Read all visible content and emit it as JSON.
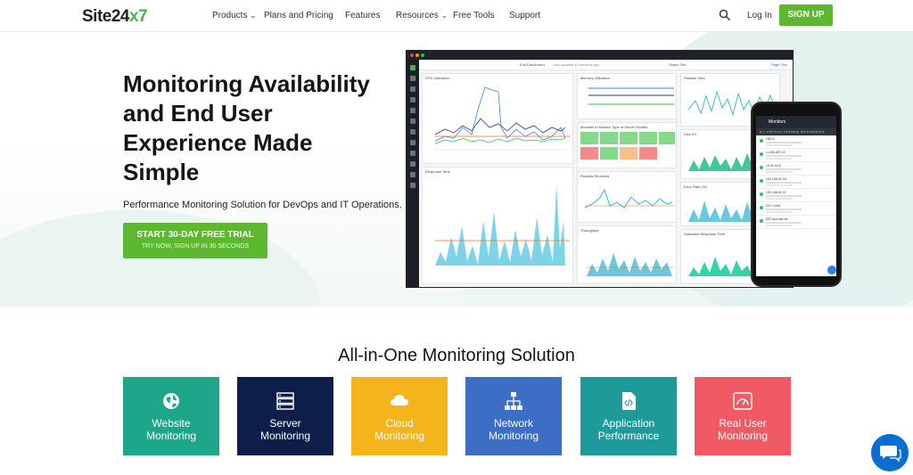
{
  "nav": {
    "logo_main": "Site24",
    "logo_accent": "x7",
    "items": [
      {
        "label": "Products",
        "dropdown": true
      },
      {
        "label": "Plans and Pricing",
        "dropdown": false
      },
      {
        "label": "Features",
        "dropdown": false
      },
      {
        "label": "Resources",
        "dropdown": true
      },
      {
        "label": "Free Tools",
        "dropdown": false
      },
      {
        "label": "Support",
        "dropdown": false
      }
    ],
    "login": "Log In",
    "signup": "SIGN UP"
  },
  "hero": {
    "headline": "Monitoring Availability and End User Experience Made Simple",
    "subtitle": "Performance Monitoring Solution for DevOps and IT Operations.",
    "cta_primary": "START 30-DAY FREE TRIAL",
    "cta_secondary": "TRY NOW, SIGN UP IN 30 SECONDS"
  },
  "dashboard": {
    "edit": "Edit Dashboard",
    "updated": "Last updated 40 seconds ago",
    "share": "Share This",
    "page": "Page This",
    "panels": {
      "cpu": "CPU Utilization",
      "memory": "Memory Utilization",
      "packets_sent": "Packets Sent",
      "monitors": "Monitors in Monitor Type of Server Monitor",
      "disk": "Disk I/O",
      "response": "Response Time",
      "packets_received": "Packets Received",
      "error_rate": "Error Rate (%)",
      "throughput": "Throughput",
      "db_response": "Database Response Time"
    }
  },
  "phone": {
    "title": "Monitors",
    "tabs": "ALL   CRITICAL   TROUBLE   MAINTENANCE",
    "rows": [
      "ODC1",
      "Lv-DB-API-13",
      "10.31.15.8",
      "192.168.62.111",
      "192.168.61.22",
      "DOT-1349",
      "IDC-tool-site-mt"
    ]
  },
  "section": {
    "title": "All-in-One Monitoring Solution",
    "cards": [
      {
        "line1": "Website",
        "line2": "Monitoring",
        "color": "#1ea68a",
        "icon": "globe-icon"
      },
      {
        "line1": "Server",
        "line2": "Monitoring",
        "color": "#0d1e4a",
        "icon": "server-icon"
      },
      {
        "line1": "Cloud",
        "line2": "Monitoring",
        "color": "#f4b51c",
        "icon": "cloud-icon"
      },
      {
        "line1": "Network",
        "line2": "Monitoring",
        "color": "#3b6ec4",
        "icon": "network-icon"
      },
      {
        "line1": "Application",
        "line2": "Performance",
        "color": "#1f9a9a",
        "icon": "code-file-icon"
      },
      {
        "line1": "Real User",
        "line2": "Monitoring",
        "color": "#ef5a64",
        "icon": "speedometer-icon"
      }
    ]
  },
  "colors": {
    "accent_green": "#5cb82e"
  }
}
